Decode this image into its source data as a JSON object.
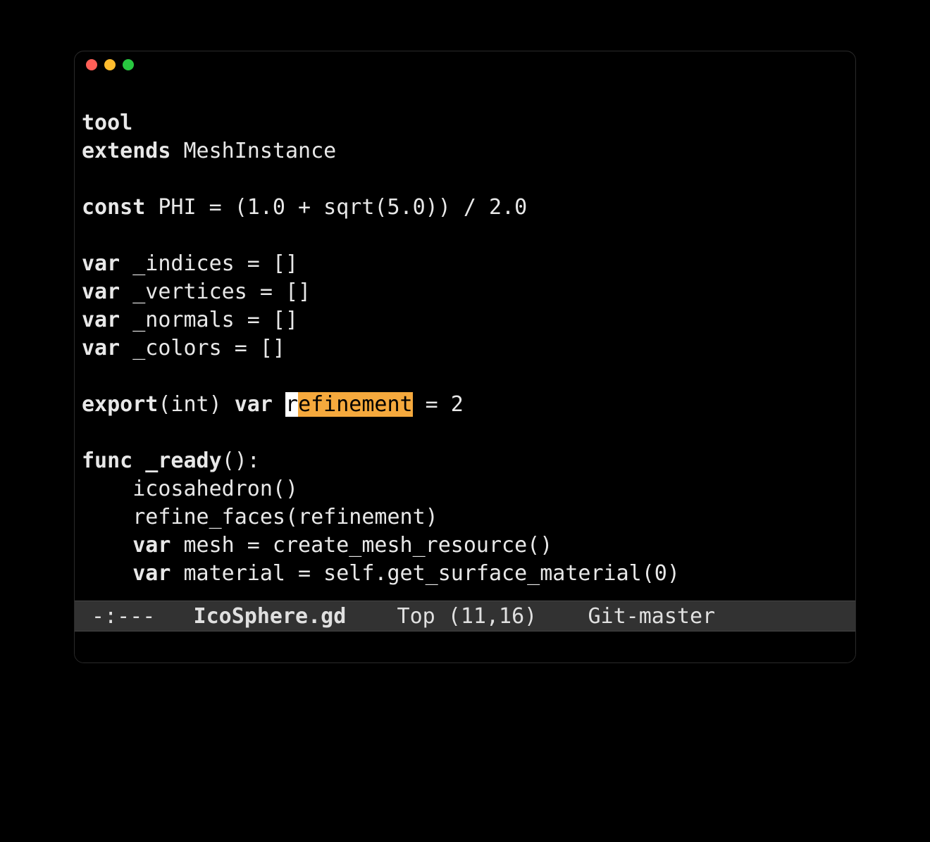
{
  "traffic": {
    "close": "#ff5f57",
    "minimize": "#febc2e",
    "zoom": "#28c840"
  },
  "code": {
    "l1_kw": "tool",
    "l2_kw": "extends",
    "l2_rest": " MeshInstance",
    "blank": "",
    "l4_kw": "const",
    "l4_rest": " PHI = (1.0 + sqrt(5.0)) / 2.0",
    "l6_kw": "var",
    "l6_rest": " _indices = []",
    "l7_kw": "var",
    "l7_rest": " _vertices = []",
    "l8_kw": "var",
    "l8_rest": " _normals = []",
    "l9_kw": "var",
    "l9_rest": " _colors = []",
    "l11_kw1": "export",
    "l11_mid1": "(int) ",
    "l11_kw2": "var",
    "l11_mid2": " ",
    "l11_hl_cursor": "r",
    "l11_hl_word": "efinement",
    "l11_rest": " = 2",
    "l13_kw": "func",
    "l13_fn": " _ready",
    "l13_rest": "():",
    "l14": "    icosahedron()",
    "l15": "    refine_faces(refinement)",
    "l16_indent": "    ",
    "l16_kw": "var",
    "l16_rest": " mesh = create_mesh_resource()",
    "l17_indent": "    ",
    "l17_kw": "var",
    "l17_rest": " material = self.get_surface_material(0)"
  },
  "modeline": {
    "left": " -:--- ",
    "filename": "  IcoSphere.gd  ",
    "position": "  Top (11,16)  ",
    "git": "  Git-master "
  }
}
